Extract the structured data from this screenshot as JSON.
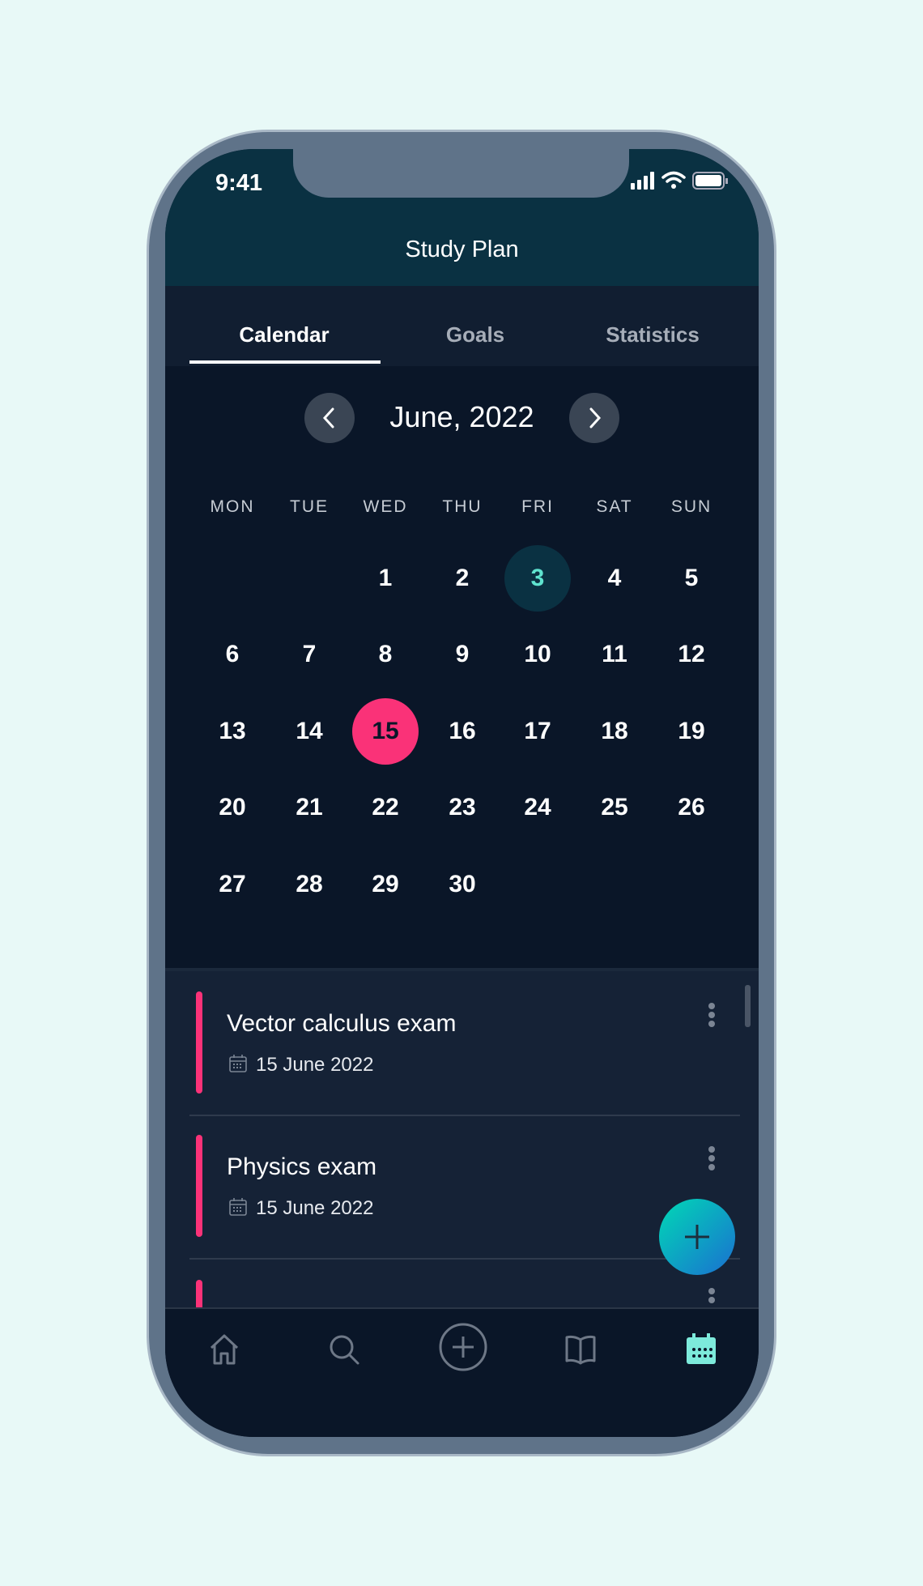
{
  "status": {
    "time": "9:41"
  },
  "header": {
    "title": "Study Plan"
  },
  "tabs": [
    {
      "label": "Calendar",
      "active": true
    },
    {
      "label": "Goals"
    },
    {
      "label": "Statistics"
    }
  ],
  "calendar": {
    "month": "June, 2022",
    "weekdays": [
      "MON",
      "TUE",
      "WED",
      "THU",
      "FRI",
      "SAT",
      "SUN"
    ],
    "days": [
      "1",
      "2",
      "3",
      "4",
      "5",
      "6",
      "7",
      "8",
      "9",
      "10",
      "11",
      "12",
      "13",
      "14",
      "15",
      "16",
      "17",
      "18",
      "19",
      "20",
      "21",
      "22",
      "23",
      "24",
      "25",
      "26",
      "27",
      "28",
      "29",
      "30"
    ],
    "today": "3",
    "selected": "15",
    "colors": {
      "today_bg": "#0a3142",
      "today_text": "#5fe3cf",
      "selected_bg": "#fa3278"
    }
  },
  "events": [
    {
      "title": "Vector calculus exam",
      "date": "15 June 2022"
    },
    {
      "title": "Physics exam",
      "date": "15 June 2022"
    }
  ],
  "colors": {
    "accent": "#fa3278",
    "active_nav": "#7deadb"
  },
  "bottom_nav": [
    "home-icon",
    "search-icon",
    "add-circle-icon",
    "book-icon",
    "calendar-icon"
  ]
}
